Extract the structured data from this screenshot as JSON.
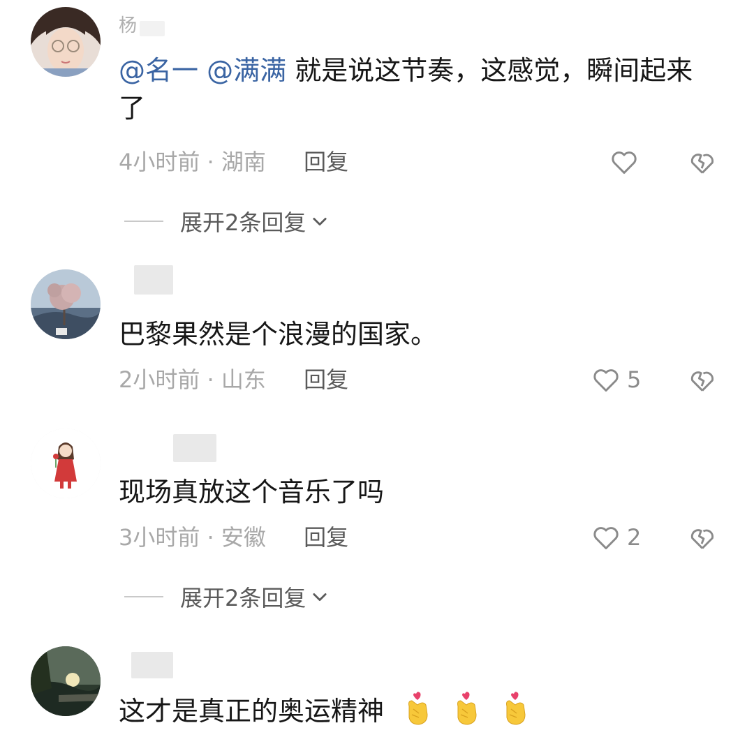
{
  "comments": [
    {
      "username_partial": "杨",
      "mentions": [
        "@名一",
        "@满满"
      ],
      "text": "就是说这节奏，这感觉，瞬间起来了",
      "time": "4小时前",
      "location": "湖南",
      "reply_label": "回复",
      "like_count": "",
      "expand_label": "展开2条回复"
    },
    {
      "username_partial": "",
      "text": "巴黎果然是个浪漫的国家。",
      "time": "2小时前",
      "location": "山东",
      "reply_label": "回复",
      "like_count": "5"
    },
    {
      "username_partial": "",
      "text": "现场真放这个音乐了吗",
      "time": "3小时前",
      "location": "安徽",
      "reply_label": "回复",
      "like_count": "2",
      "expand_label": "展开2条回复"
    },
    {
      "username_partial": "",
      "text": "这才是真正的奥运精神",
      "emoji_count": 3,
      "emoji_name": "finger-heart-emoji"
    }
  ],
  "separator": "·",
  "colors": {
    "mention": "#3a64a3",
    "text": "#161616",
    "meta": "#a8a8a8"
  }
}
